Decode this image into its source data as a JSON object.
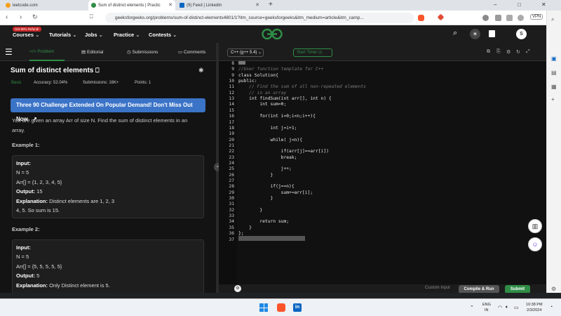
{
  "browser": {
    "tabs": [
      {
        "label": "leetcode.com",
        "active": false
      },
      {
        "label": "Sum of distinct elements | Practic",
        "active": true
      },
      {
        "label": "(9) Feed | LinkedIn",
        "active": false
      }
    ],
    "new_tab": "+",
    "url": "geeksforgeeks.org/problems/sum-of-distinct-elements4801/1?itm_source=geeksforgeeks&itm_medium=article&itm_camp...",
    "vpn_label": "VPN",
    "window_controls": [
      "–",
      "□",
      "✕"
    ]
  },
  "gfg_header": {
    "refund_badge": "Get 90% Refund!",
    "nav": [
      "Courses",
      "Tutorials",
      "Jobs",
      "Practice",
      "Contests"
    ],
    "logo": "GfG",
    "avatar": "S"
  },
  "problem_tabs": [
    "Problem",
    "Editorial",
    "Submissions",
    "Comments"
  ],
  "problem": {
    "title": "Sum of distinct elements",
    "difficulty": "Basic",
    "accuracy": "Accuracy: 52.04%",
    "submissions": "Submissions: 16K+",
    "points": "Points: 1",
    "banner": "Three 90 Challenge Extended On Popular Demand! Don't Miss Out Now",
    "statement_1": "You are given an array Arr of size N. Find the sum of distinct elements in an",
    "statement_2": "array.",
    "example1_label": "Example 1:",
    "example1": {
      "input_label": "Input:",
      "n": "N = 5",
      "arr": "Arr[] = {1, 2, 3, 4, 5}",
      "output_label": "Output:",
      "output": "15",
      "explanation_label": "Explanation:",
      "explanation_1": "Distinct elements are 1, 2, 3",
      "explanation_2": "4, 5. So sum is 15."
    },
    "example2_label": "Example 2:",
    "example2": {
      "input_label": "Input:",
      "n": "N = 5",
      "arr": "Arr[] = {5, 5, 5, 5, 5}",
      "output_label": "Output:",
      "output": "5",
      "explanation_label": "Explanation:",
      "explanation_1": "Only Distinct element is 5."
    }
  },
  "editor": {
    "language": "C++ (g++ 5.4)",
    "timer": "Start Timer",
    "lines": [
      {
        "n": "8",
        "text": "",
        "cls": ""
      },
      {
        "n": "9",
        "text": "//User function template for C++",
        "cls": "cmt"
      },
      {
        "n": "9",
        "text": "class Solution{",
        "cls": ""
      },
      {
        "n": "10",
        "text": "public:",
        "cls": ""
      },
      {
        "n": "11",
        "text": "    // Find the sum of all non-repeated elements",
        "cls": "cmt"
      },
      {
        "n": "12",
        "text": "    // in an array",
        "cls": "cmt"
      },
      {
        "n": "13",
        "text": "    int findSum(int arr[], int n) {",
        "cls": ""
      },
      {
        "n": "14",
        "text": "        int sum=0;",
        "cls": ""
      },
      {
        "n": "15",
        "text": "",
        "cls": ""
      },
      {
        "n": "16",
        "text": "        for(int i=0;i<n;i++){",
        "cls": ""
      },
      {
        "n": "17",
        "text": "",
        "cls": ""
      },
      {
        "n": "18",
        "text": "            int j=i+1;",
        "cls": ""
      },
      {
        "n": "19",
        "text": "",
        "cls": ""
      },
      {
        "n": "20",
        "text": "            while( j<n){",
        "cls": ""
      },
      {
        "n": "21",
        "text": "",
        "cls": ""
      },
      {
        "n": "22",
        "text": "                if(arr[j]==arr[i])",
        "cls": ""
      },
      {
        "n": "23",
        "text": "                break;",
        "cls": ""
      },
      {
        "n": "24",
        "text": "",
        "cls": ""
      },
      {
        "n": "25",
        "text": "                j++;",
        "cls": ""
      },
      {
        "n": "26",
        "text": "            }",
        "cls": ""
      },
      {
        "n": "27",
        "text": "",
        "cls": ""
      },
      {
        "n": "28",
        "text": "            if(j==n){",
        "cls": ""
      },
      {
        "n": "29",
        "text": "                sum+=arr[i];",
        "cls": ""
      },
      {
        "n": "30",
        "text": "            }",
        "cls": ""
      },
      {
        "n": "31",
        "text": "",
        "cls": ""
      },
      {
        "n": "32",
        "text": "        }",
        "cls": ""
      },
      {
        "n": "33",
        "text": "",
        "cls": ""
      },
      {
        "n": "34",
        "text": "        return sum;",
        "cls": ""
      },
      {
        "n": "35",
        "text": "    }",
        "cls": ""
      },
      {
        "n": "36",
        "text": "};",
        "cls": ""
      },
      {
        "n": "37",
        "text": "",
        "cls": ""
      }
    ],
    "custom_input": "Custom Input",
    "compile_label": "Compile & Run",
    "submit_label": "Submit"
  },
  "taskbar": {
    "lang": "ENG",
    "region": "IN",
    "time": "10:38 PM",
    "date": "2/3/2024"
  }
}
